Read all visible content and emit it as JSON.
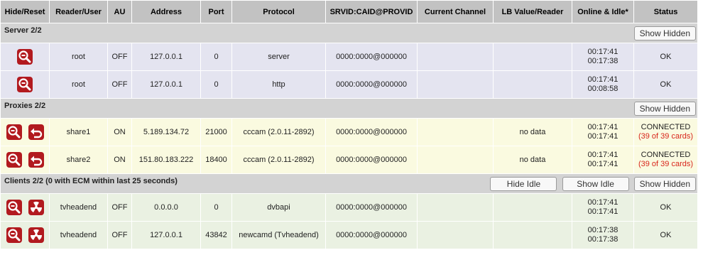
{
  "headers": [
    "Hide/Reset",
    "Reader/User",
    "AU",
    "Address",
    "Port",
    "Protocol",
    "SRVID:CAID@PROVID",
    "Current Channel",
    "LB Value/Reader",
    "Online & Idle*",
    "Status"
  ],
  "sections": {
    "server": {
      "title": "Server 2/2",
      "show_hidden_label": "Show Hidden",
      "rows": [
        {
          "user": "root",
          "au": "OFF",
          "address": "127.0.0.1",
          "port": "0",
          "protocol": "server",
          "srvid": "0000:0000@000000",
          "channel": "",
          "lb": "",
          "online": "00:17:41",
          "idle": "00:17:38",
          "status": "OK"
        },
        {
          "user": "root",
          "au": "OFF",
          "address": "127.0.0.1",
          "port": "0",
          "protocol": "http",
          "srvid": "0000:0000@000000",
          "channel": "",
          "lb": "",
          "online": "00:17:41",
          "idle": "00:08:58",
          "status": "OK"
        }
      ]
    },
    "proxies": {
      "title": "Proxies 2/2",
      "show_hidden_label": "Show Hidden",
      "rows": [
        {
          "user": "share1",
          "au": "ON",
          "address": "5.189.134.72",
          "port": "21000",
          "protocol": "cccam (2.0.11-2892)",
          "srvid": "0000:0000@000000",
          "channel": "",
          "lb": "no data",
          "online": "00:17:41",
          "idle": "00:17:41",
          "status": "CONNECTED",
          "cards": "(39 of 39 cards)"
        },
        {
          "user": "share2",
          "au": "ON",
          "address": "151.80.183.222",
          "port": "18400",
          "protocol": "cccam (2.0.11-2892)",
          "srvid": "0000:0000@000000",
          "channel": "",
          "lb": "no data",
          "online": "00:17:41",
          "idle": "00:17:41",
          "status": "CONNECTED",
          "cards": "(39 of 39 cards)"
        }
      ]
    },
    "clients": {
      "title": "Clients 2/2 (0 with ECM within last 25 seconds)",
      "hide_idle_label": "Hide Idle",
      "show_idle_label": "Show Idle",
      "show_hidden_label": "Show Hidden",
      "rows": [
        {
          "user": "tvheadend",
          "au": "OFF",
          "address": "0.0.0.0",
          "port": "0",
          "protocol": "dvbapi",
          "srvid": "0000:0000@000000",
          "channel": "",
          "lb": "",
          "online": "00:17:41",
          "idle": "00:17:41",
          "status": "OK"
        },
        {
          "user": "tvheadend",
          "au": "OFF",
          "address": "127.0.0.1",
          "port": "43842",
          "protocol": "newcamd (Tvheadend)",
          "srvid": "0000:0000@000000",
          "channel": "",
          "lb": "",
          "online": "00:17:38",
          "idle": "00:17:38",
          "status": "OK"
        }
      ]
    }
  },
  "icons": {
    "hide": "magnifier-minus-icon",
    "reset": "reset-arrow-icon",
    "kill": "radiation-icon"
  },
  "colors": {
    "header_bg": "#c2c2c2",
    "section_bg": "#d3d3d3",
    "server_row_bg": "#e4e4f0",
    "proxy_row_bg": "#fafae0",
    "client_row_bg": "#eaf1e2",
    "icon_red": "#b21a1f",
    "cards_red": "#d8261b"
  }
}
